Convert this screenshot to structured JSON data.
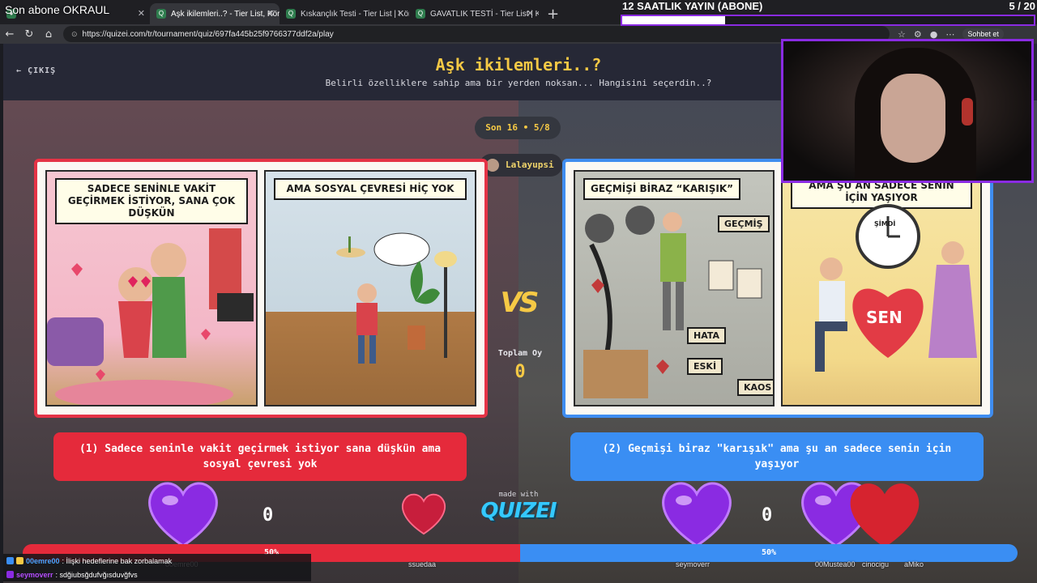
{
  "browser": {
    "tabs": [
      {
        "label": "Son abone OKRAUL",
        "active": false
      },
      {
        "label": "Aşk ikilemleri..? - Tier List, Kör Sıra",
        "active": true
      },
      {
        "label": "Kıskançlık Testi - Tier List | Kör Sıra",
        "active": false
      },
      {
        "label": "GAVATLIK TESTİ - Tier List | Kör Sıra",
        "active": false
      }
    ],
    "url": "https://quizei.com/tr/tournament/quiz/697fa445b25f9766377ddf2a/play",
    "chat_button": "Sohbet et"
  },
  "overlay": {
    "top_left": "Son abone OKRAUL",
    "goal_label": "12 SAATLIK YAYIN (ABONE)",
    "goal_count": "5 / 20",
    "goal_progress": 0.25
  },
  "quiz": {
    "exit_label": "ÇIKIŞ",
    "title": "Aşk ikilemleri..?",
    "subtitle": "Belirli özelliklere sahip ama bir yerden noksan... Hangisini seçerdin..?",
    "round": "Son 16 • 5/8",
    "user": "Lalayupsi",
    "vs": "VS",
    "total_label": "Toplam Oy",
    "total_value": "0",
    "made_with": "made with",
    "brand": "QUIZEI",
    "left": {
      "panel1_caption": "SADECE SENİNLE VAKİT GEÇİRMEK İSTİYOR, SANA ÇOK DÜŞKÜN",
      "panel2_caption": "AMA SOSYAL ÇEVRESİ HİÇ YOK",
      "choice": "(1) Sadece seninle vakit geçirmek istiyor sana düşkün ama sosyal çevresi yok",
      "votes": "0",
      "percent": "50%"
    },
    "right": {
      "panel1_caption": "GEÇMİŞİ BİRAZ “KARIŞIK”",
      "panel1_tag": "GEÇMİŞ",
      "panel1_box1": "HATA",
      "panel1_box2": "ESKİ",
      "panel1_box3": "KAOS",
      "panel2_caption": "AMA ŞU AN SADECE SENİN İÇİN YAŞIYOR",
      "panel2_clock": "ŞİMDİ",
      "panel2_heart": "SEN",
      "choice": "(2) Geçmişi biraz \"karışık\" ama şu an sadece senin için yaşıyor",
      "votes": "0",
      "percent": "50%"
    },
    "split": 0.5,
    "voters": [
      "00emre00",
      "ssuedaa",
      "seymoverr",
      "00Mustea00",
      "cinocigu",
      "aMiko"
    ]
  },
  "chat": [
    {
      "user": "00emre00",
      "message": ": İlişki hedeflerine bak zorbalamak",
      "color": "#4aa3ff"
    },
    {
      "user": "seymoverr",
      "message": ": sdğiubsğdufvğısduvğfvs",
      "color": "#b44dff"
    }
  ]
}
